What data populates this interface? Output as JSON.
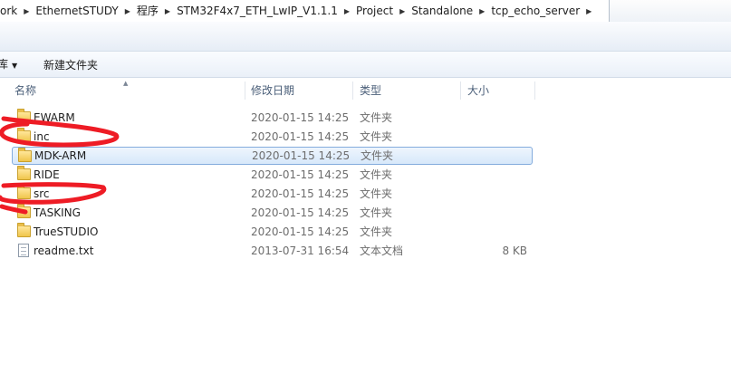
{
  "breadcrumb": [
    "ork",
    "EthernetSTUDY",
    "程序",
    "STM32F4x7_ETH_LwIP_V1.1.1",
    "Project",
    "Standalone",
    "tcp_echo_server"
  ],
  "toolbar": {
    "organize": "库",
    "new_folder": "新建文件夹"
  },
  "columns": {
    "name": "名称",
    "date": "修改日期",
    "type": "类型",
    "size": "大小"
  },
  "files": [
    {
      "name": "EWARM",
      "date": "2020-01-15 14:25",
      "type": "文件夹",
      "size": "",
      "icon": "folder-icon"
    },
    {
      "name": "inc",
      "date": "2020-01-15 14:25",
      "type": "文件夹",
      "size": "",
      "icon": "folder-icon"
    },
    {
      "name": "MDK-ARM",
      "date": "2020-01-15 14:25",
      "type": "文件夹",
      "size": "",
      "icon": "folder-icon",
      "selected": true
    },
    {
      "name": "RIDE",
      "date": "2020-01-15 14:25",
      "type": "文件夹",
      "size": "",
      "icon": "folder-icon"
    },
    {
      "name": "src",
      "date": "2020-01-15 14:25",
      "type": "文件夹",
      "size": "",
      "icon": "folder-icon"
    },
    {
      "name": "TASKING",
      "date": "2020-01-15 14:25",
      "type": "文件夹",
      "size": "",
      "icon": "folder-icon"
    },
    {
      "name": "TrueSTUDIO",
      "date": "2020-01-15 14:25",
      "type": "文件夹",
      "size": "",
      "icon": "folder-icon"
    },
    {
      "name": "readme.txt",
      "date": "2013-07-31 16:54",
      "type": "文本文档",
      "size": "8 KB",
      "icon": "text-file-icon"
    }
  ],
  "colors": {
    "selection_border": "#84acdd",
    "annotation": "#ee1c25"
  }
}
